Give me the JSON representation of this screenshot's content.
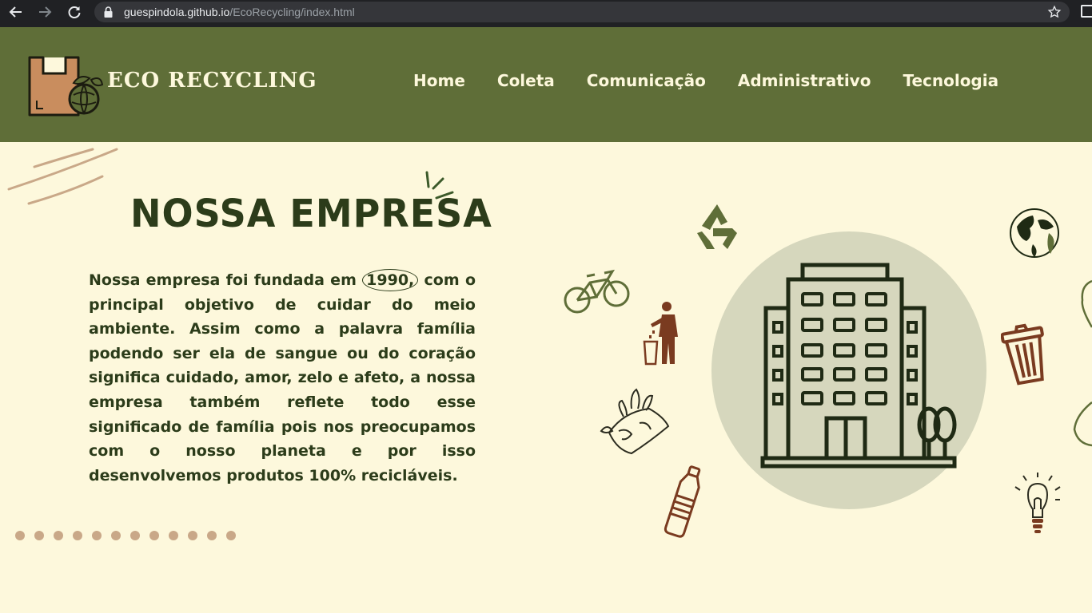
{
  "browser": {
    "url_host": "guespindola.github.io",
    "url_path": "/EcoRecycling/index.html"
  },
  "header": {
    "brand": "ECO RECYCLING",
    "menu": [
      "Home",
      "Coleta",
      "Comunicação",
      "Administrativo",
      "Tecnologia"
    ]
  },
  "main": {
    "title": "NOSSA EMPRESA",
    "text_before": "Nossa empresa foi fundada em ",
    "highlight": "1990,",
    "text_after": " com o principal objetivo de cuidar do meio ambiente. Assim como a palavra família podendo ser ela de sangue ou do coração significa cuidado, amor, zelo e afeto, a nossa empresa também reflete todo esse significado de família pois nos preocupamos com o nosso planeta e por isso desenvolvemos produtos 100% recicláveis."
  },
  "colors": {
    "header_bg": "#5f6e38",
    "page_bg": "#fdf8dc",
    "title": "#2c3c1a",
    "accent_brown": "#7a3b20",
    "circle": "#d6d7bd"
  },
  "icons": [
    "back-icon",
    "forward-icon",
    "reload-icon",
    "lock-icon",
    "star-icon",
    "recycle-icon",
    "globe-icon",
    "bicycle-icon",
    "person-trash-icon",
    "trash-can-icon",
    "building-icon",
    "earth-plants-icon",
    "bottle-icon",
    "lightbulb-icon"
  ]
}
